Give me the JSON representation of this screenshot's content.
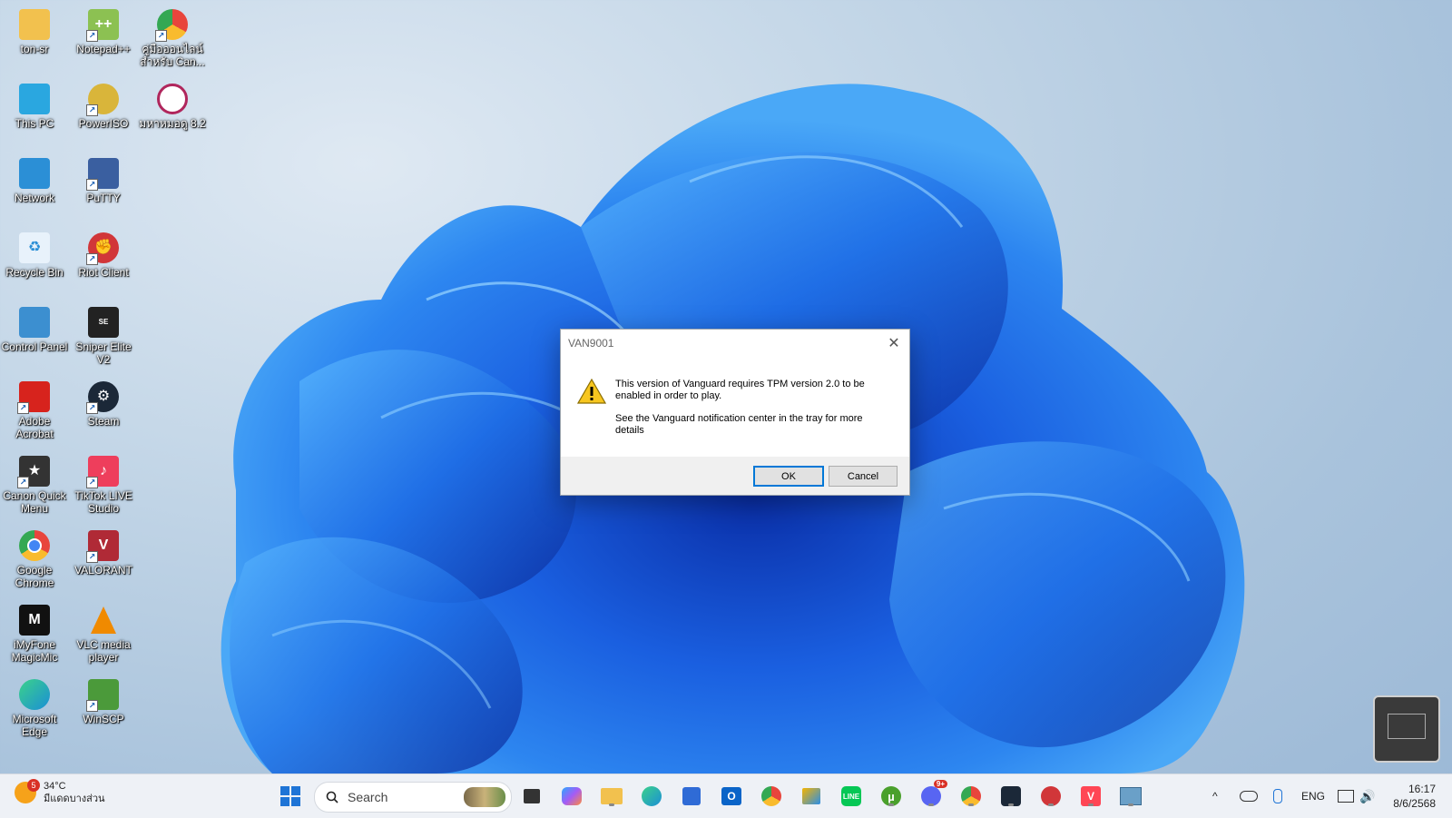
{
  "desktop": {
    "icons": [
      {
        "label": "ton-sr",
        "icon": "folder-icon",
        "color": "#f2c14e"
      },
      {
        "label": "This PC",
        "icon": "monitor-icon",
        "color": "#2aa7e0"
      },
      {
        "label": "Network",
        "icon": "network-icon",
        "color": "#2b8fd6"
      },
      {
        "label": "Recycle Bin",
        "icon": "recycle-bin-icon",
        "color": "#6fb6e8"
      },
      {
        "label": "Control Panel",
        "icon": "control-panel-icon",
        "color": "#3c8fd0"
      },
      {
        "label": "Adobe Acrobat",
        "icon": "acrobat-icon",
        "color": "#d7231d"
      },
      {
        "label": "Canon Quick Menu",
        "icon": "canon-icon",
        "color": "#333333"
      },
      {
        "label": "Google Chrome",
        "icon": "chrome-icon",
        "color": "#e8453c"
      },
      {
        "label": "iMyFone MagicMic",
        "icon": "magicmic-icon",
        "color": "#111111"
      },
      {
        "label": "Microsoft Edge",
        "icon": "edge-icon",
        "color": "#1b8fd6"
      },
      {
        "label": "Notepad++",
        "icon": "notepad-plus-plus-icon",
        "color": "#8cc152"
      },
      {
        "label": "PowerISO",
        "icon": "poweriso-icon",
        "color": "#d9b53a"
      },
      {
        "label": "PuTTY",
        "icon": "putty-icon",
        "color": "#3a5fa0"
      },
      {
        "label": "Riot Client",
        "icon": "riot-client-icon",
        "color": "#d13639"
      },
      {
        "label": "Sniper Elite V2",
        "icon": "sniper-elite-icon",
        "color": "#222222"
      },
      {
        "label": "Steam",
        "icon": "steam-icon",
        "color": "#1b2838"
      },
      {
        "label": "TikTok LIVE Studio",
        "icon": "tiktok-icon",
        "color": "#ee3e5c"
      },
      {
        "label": "VALORANT",
        "icon": "valorant-icon",
        "color": "#b02a36"
      },
      {
        "label": "VLC media player",
        "icon": "vlc-icon",
        "color": "#f08a00"
      },
      {
        "label": "WinSCP",
        "icon": "winscp-icon",
        "color": "#4b9a3a"
      },
      {
        "label": "คู่มือออนไลน์สำหรับ Can...",
        "icon": "chrome-shortcut-icon",
        "color": "#e8453c"
      },
      {
        "label": "มหาหมอดู 8.2",
        "icon": "astrology-icon",
        "color": "#b0265c"
      }
    ]
  },
  "dialog": {
    "title": "VAN9001",
    "close_glyph": "✕",
    "message_line1": "This version of Vanguard requires TPM version 2.0 to be enabled in order to play.",
    "message_line2": "See the Vanguard notification center in the tray for more details",
    "ok_label": "OK",
    "cancel_label": "Cancel",
    "icon": "warning-icon"
  },
  "taskbar": {
    "weather_temp": "34°C",
    "weather_desc": "มีแดดบางส่วน",
    "weather_badge": "5",
    "search_placeholder": "Search",
    "apps": [
      {
        "name": "start-button",
        "color": "#1e74d6"
      },
      {
        "name": "taskview-button",
        "color": "#333333"
      },
      {
        "name": "copilot-button",
        "color": "#8a5cf6"
      },
      {
        "name": "file-explorer-button",
        "color": "#f2c14e"
      },
      {
        "name": "edge-button",
        "color": "#1b8fd6"
      },
      {
        "name": "store-button",
        "color": "#2f6bd6"
      },
      {
        "name": "outlook-button",
        "color": "#0a64c8"
      },
      {
        "name": "chrome-button",
        "color": "#e8453c"
      },
      {
        "name": "files-button",
        "color": "#f5b400"
      },
      {
        "name": "line-button",
        "color": "#06c755"
      },
      {
        "name": "utorrent-button",
        "color": "#4aa02c"
      },
      {
        "name": "discord-button",
        "color": "#5865f2"
      },
      {
        "name": "chrome-profile-button",
        "color": "#e8453c"
      },
      {
        "name": "app-dark-button",
        "color": "#1b2838"
      },
      {
        "name": "riot-button",
        "color": "#d13639"
      },
      {
        "name": "valorant-button",
        "color": "#ff4655"
      },
      {
        "name": "generic-app-button",
        "color": "#6aa0c8"
      }
    ],
    "discord_badge": "9+",
    "tray_chevron": "^",
    "language": "ENG",
    "time": "16:17",
    "date": "8/6/2568"
  }
}
